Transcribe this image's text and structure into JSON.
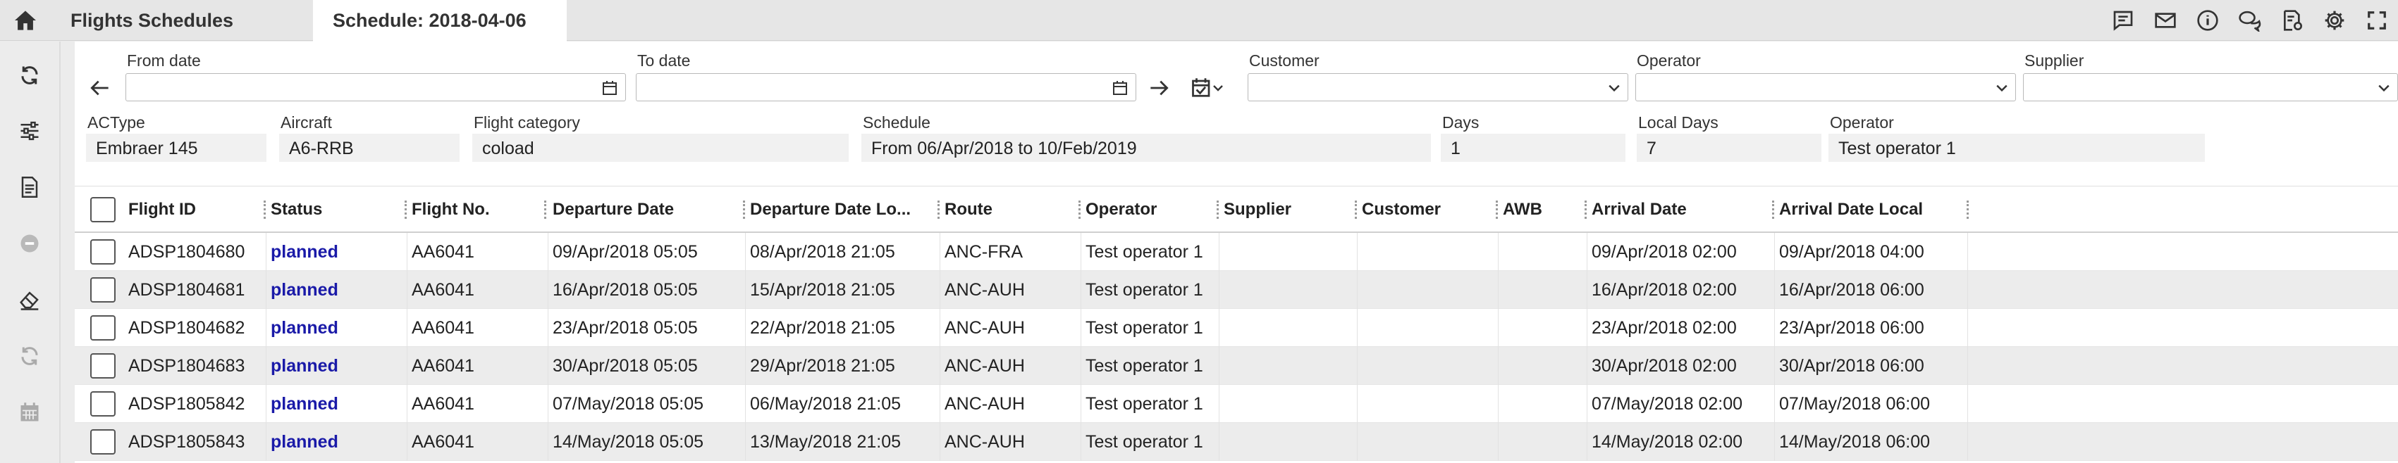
{
  "topbar": {
    "tabs": [
      {
        "label": "Flights Schedules"
      },
      {
        "label": "Schedule: 2018-04-06"
      }
    ]
  },
  "filters": {
    "from_date": {
      "label": "From date",
      "value": ""
    },
    "to_date": {
      "label": "To date",
      "value": ""
    },
    "customer": {
      "label": "Customer",
      "value": ""
    },
    "operator": {
      "label": "Operator",
      "value": ""
    },
    "supplier": {
      "label": "Supplier",
      "value": ""
    }
  },
  "details": {
    "actype": {
      "label": "ACType",
      "value": "Embraer 145"
    },
    "aircraft": {
      "label": "Aircraft",
      "value": "A6-RRB"
    },
    "flight_category": {
      "label": "Flight category",
      "value": "coload"
    },
    "schedule": {
      "label": "Schedule",
      "value": "From 06/Apr/2018 to 10/Feb/2019"
    },
    "days": {
      "label": "Days",
      "value": "1"
    },
    "local_days": {
      "label": "Local Days",
      "value": "7"
    },
    "operator": {
      "label": "Operator",
      "value": "Test operator 1"
    }
  },
  "grid": {
    "columns": [
      "Flight ID",
      "Status",
      "Flight No.",
      "Departure Date",
      "Departure Date Lo...",
      "Route",
      "Operator",
      "Supplier",
      "Customer",
      "AWB",
      "Arrival Date",
      "Arrival Date Local"
    ],
    "rows": [
      {
        "flight_id": "ADSP1804680",
        "status": "planned",
        "flight_no": "AA6041",
        "departure_date": "09/Apr/2018 05:05",
        "departure_date_local": "08/Apr/2018 21:05",
        "route": "ANC-FRA",
        "operator": "Test operator 1",
        "supplier": "",
        "customer": "",
        "awb": "",
        "arrival_date": "09/Apr/2018 02:00",
        "arrival_date_local": "09/Apr/2018 04:00"
      },
      {
        "flight_id": "ADSP1804681",
        "status": "planned",
        "flight_no": "AA6041",
        "departure_date": "16/Apr/2018 05:05",
        "departure_date_local": "15/Apr/2018 21:05",
        "route": "ANC-AUH",
        "operator": "Test operator 1",
        "supplier": "",
        "customer": "",
        "awb": "",
        "arrival_date": "16/Apr/2018 02:00",
        "arrival_date_local": "16/Apr/2018 06:00"
      },
      {
        "flight_id": "ADSP1804682",
        "status": "planned",
        "flight_no": "AA6041",
        "departure_date": "23/Apr/2018 05:05",
        "departure_date_local": "22/Apr/2018 21:05",
        "route": "ANC-AUH",
        "operator": "Test operator 1",
        "supplier": "",
        "customer": "",
        "awb": "",
        "arrival_date": "23/Apr/2018 02:00",
        "arrival_date_local": "23/Apr/2018 06:00"
      },
      {
        "flight_id": "ADSP1804683",
        "status": "planned",
        "flight_no": "AA6041",
        "departure_date": "30/Apr/2018 05:05",
        "departure_date_local": "29/Apr/2018 21:05",
        "route": "ANC-AUH",
        "operator": "Test operator 1",
        "supplier": "",
        "customer": "",
        "awb": "",
        "arrival_date": "30/Apr/2018 02:00",
        "arrival_date_local": "30/Apr/2018 06:00"
      },
      {
        "flight_id": "ADSP1805842",
        "status": "planned",
        "flight_no": "AA6041",
        "departure_date": "07/May/2018 05:05",
        "departure_date_local": "06/May/2018 21:05",
        "route": "ANC-AUH",
        "operator": "Test operator 1",
        "supplier": "",
        "customer": "",
        "awb": "",
        "arrival_date": "07/May/2018 02:00",
        "arrival_date_local": "07/May/2018 06:00"
      },
      {
        "flight_id": "ADSP1805843",
        "status": "planned",
        "flight_no": "AA6041",
        "departure_date": "14/May/2018 05:05",
        "departure_date_local": "13/May/2018 21:05",
        "route": "ANC-AUH",
        "operator": "Test operator 1",
        "supplier": "",
        "customer": "",
        "awb": "",
        "arrival_date": "14/May/2018 02:00",
        "arrival_date_local": "14/May/2018 06:00"
      }
    ]
  },
  "colors": {
    "status_planned": "#1a1aa8",
    "row_alt": "#ececec",
    "active_tab": "#ffffff"
  }
}
